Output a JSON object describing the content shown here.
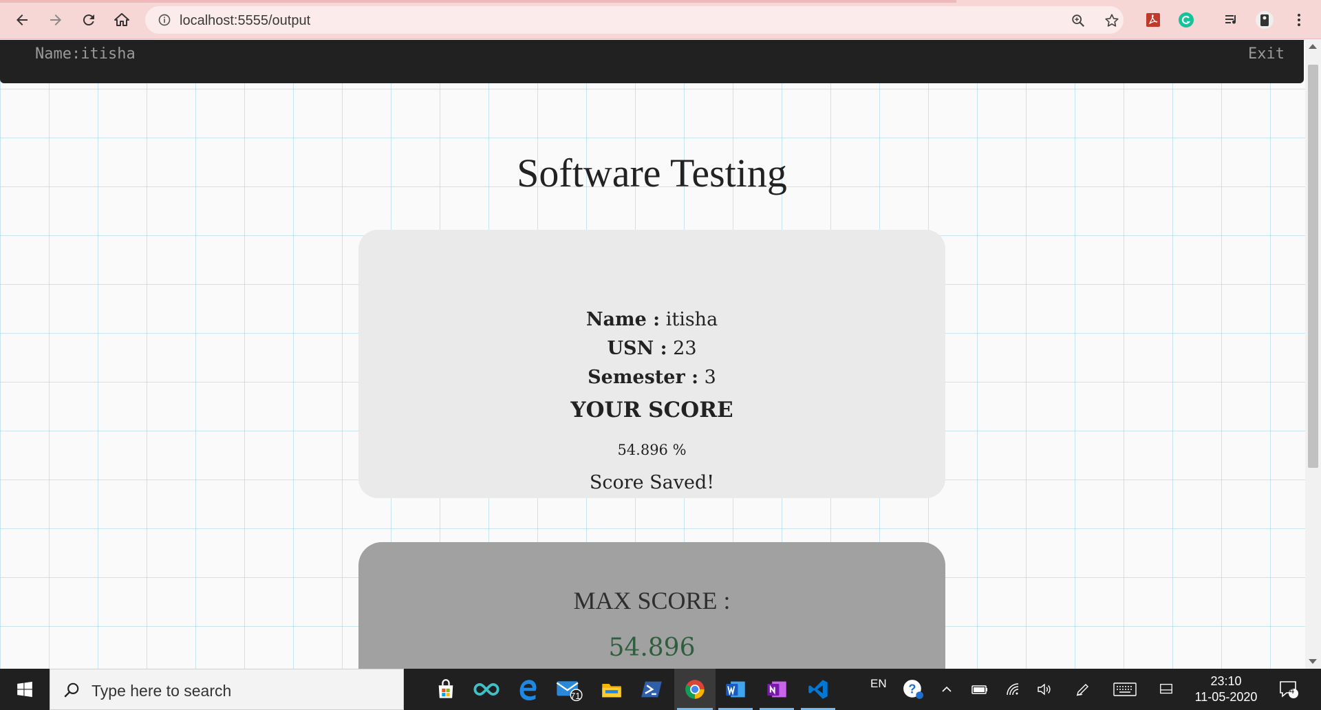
{
  "browser": {
    "url": "localhost:5555/output"
  },
  "page": {
    "topnav": {
      "name_label": "Name:itisha",
      "exit_label": "Exit"
    },
    "title": "Software Testing",
    "result": {
      "name_label": "Name :",
      "name_value": " itisha",
      "usn_label": "USN :",
      "usn_value": " 23",
      "semester_label": "Semester :",
      "semester_value": " 3",
      "score_heading": "YOUR SCORE",
      "score_value": "54.896 %",
      "status": "Score Saved!"
    },
    "max": {
      "label": "MAX SCORE :",
      "value": "54.896"
    }
  },
  "taskbar": {
    "search_placeholder": "Type here to search",
    "mail_badge": "71",
    "language": "EN",
    "time": "23:10",
    "date": "11-05-2020",
    "notification_count": "4",
    "apps": [
      "store-icon",
      "infinity-icon",
      "edge-icon",
      "mail-icon",
      "file-explorer-icon",
      "powershell-icon",
      "chrome-icon",
      "word-icon",
      "onenote-icon",
      "vscode-icon"
    ]
  },
  "colors": {
    "chrome_bg": "#f7d6d6",
    "topnav_bg": "#212121",
    "card_bg": "#eaeaeb",
    "max_card_bg": "#a1a1a2",
    "max_value": "#2e5e3e"
  }
}
